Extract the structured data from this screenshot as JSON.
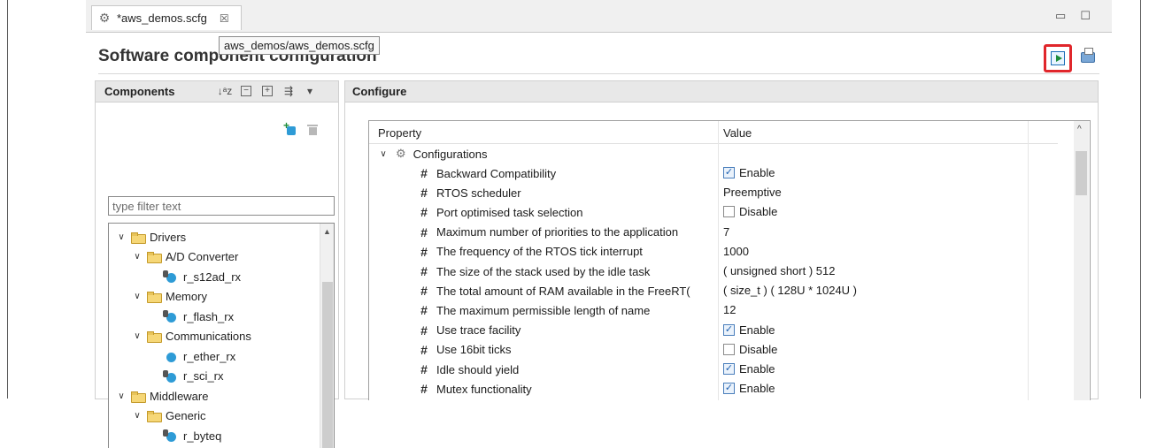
{
  "tab": {
    "icon": "gear-icon",
    "title": "*aws_demos.scfg",
    "close": "☒",
    "tooltip": "aws_demos/aws_demos.scfg"
  },
  "window_controls": {
    "minimize": "▭",
    "maximize": "☐"
  },
  "editor": {
    "title": "Software component configuration",
    "generate_icon": "generate-code-icon",
    "report_icon": "generate-report-icon"
  },
  "components": {
    "title": "Components",
    "filter_placeholder": "type filter text",
    "tree": [
      {
        "label": "Drivers",
        "level": 0,
        "type": "folder",
        "expanded": true
      },
      {
        "label": "A/D Converter",
        "level": 1,
        "type": "folder",
        "expanded": true
      },
      {
        "label": "r_s12ad_rx",
        "level": 2,
        "type": "component"
      },
      {
        "label": "Memory",
        "level": 1,
        "type": "folder",
        "expanded": true
      },
      {
        "label": "r_flash_rx",
        "level": 2,
        "type": "component"
      },
      {
        "label": "Communications",
        "level": 1,
        "type": "folder",
        "expanded": true
      },
      {
        "label": "r_ether_rx",
        "level": 2,
        "type": "component-plain"
      },
      {
        "label": "r_sci_rx",
        "level": 2,
        "type": "component"
      },
      {
        "label": "Middleware",
        "level": 0,
        "type": "folder",
        "expanded": true
      },
      {
        "label": "Generic",
        "level": 1,
        "type": "folder",
        "expanded": true
      },
      {
        "label": "r_byteq",
        "level": 2,
        "type": "component"
      }
    ]
  },
  "configure": {
    "title": "Configure",
    "columns": {
      "property": "Property",
      "value": "Value"
    },
    "group": "Configurations",
    "rows": [
      {
        "property": "Backward Compatibility",
        "value": "Enable",
        "checkbox": true,
        "checked": true
      },
      {
        "property": "RTOS scheduler",
        "value": "Preemptive",
        "checkbox": false
      },
      {
        "property": "Port optimised task selection",
        "value": "Disable",
        "checkbox": true,
        "checked": false
      },
      {
        "property": "Maximum number of priorities to the application",
        "value": "7",
        "checkbox": false
      },
      {
        "property": "The frequency of the RTOS tick interrupt",
        "value": "1000",
        "checkbox": false
      },
      {
        "property": "The size of the stack used by the idle task",
        "value": "( unsigned short ) 512",
        "checkbox": false
      },
      {
        "property": "The total amount of RAM available in the FreeRT(",
        "value": "( size_t ) ( 128U * 1024U )",
        "checkbox": false
      },
      {
        "property": "The maximum permissible length of name",
        "value": "12",
        "checkbox": false
      },
      {
        "property": "Use trace facility",
        "value": "Enable",
        "checkbox": true,
        "checked": true
      },
      {
        "property": "Use 16bit ticks",
        "value": "Disable",
        "checkbox": true,
        "checked": false
      },
      {
        "property": "Idle should yield",
        "value": "Enable",
        "checkbox": true,
        "checked": true
      },
      {
        "property": "Mutex functionality",
        "value": "Enable",
        "checkbox": true,
        "checked": true
      }
    ]
  }
}
